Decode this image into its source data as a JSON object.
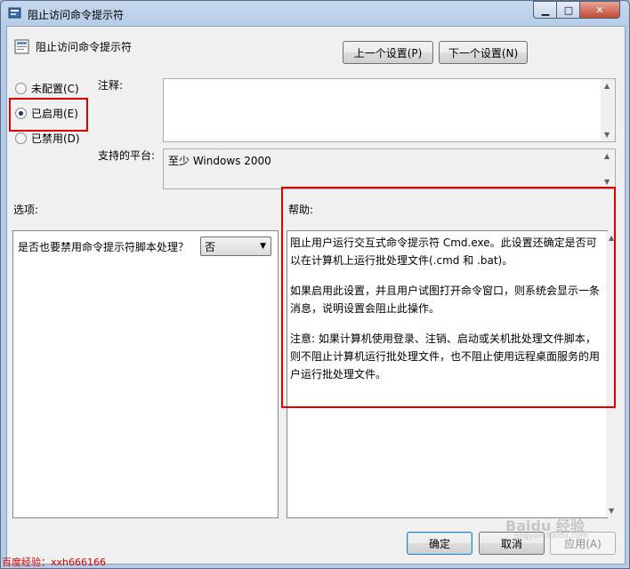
{
  "window": {
    "title": "阻止访问命令提示符"
  },
  "caption_buttons": {
    "minimize": "▁",
    "maximize": "□",
    "close": "✕"
  },
  "header": {
    "title": "阻止访问命令提示符"
  },
  "nav": {
    "prev_label": "上一个设置(P)",
    "next_label": "下一个设置(N)"
  },
  "state": {
    "options": [
      {
        "label": "未配置(C)",
        "checked": false
      },
      {
        "label": "已启用(E)",
        "checked": true
      },
      {
        "label": "已禁用(D)",
        "checked": false
      }
    ]
  },
  "comment": {
    "label": "注释:",
    "value": ""
  },
  "platform": {
    "label": "支持的平台:",
    "value": "至少 Windows 2000"
  },
  "options_section": {
    "label": "选项:",
    "question": "是否也要禁用命令提示符脚本处理？",
    "select_value": "否"
  },
  "help_section": {
    "label": "帮助:",
    "paragraphs": [
      "阻止用户运行交互式命令提示符 Cmd.exe。此设置还确定是否可以在计算机上运行批处理文件(.cmd 和 .bat)。",
      "如果启用此设置，并且用户试图打开命令窗口，则系统会显示一条消息，说明设置会阻止此操作。",
      "注意: 如果计算机使用登录、注销、启动或关机批处理文件脚本，则不阻止计算机运行批处理文件，也不阻止使用远程桌面服务的用户运行批处理文件。"
    ]
  },
  "footer": {
    "ok_label": "确定",
    "cancel_label": "取消",
    "apply_label": "应用(A)"
  },
  "watermark": {
    "left_text": "百度经验：xxh666166",
    "right_text": "Baidu 经验",
    "right_sub": "jingyan.baidu.com"
  },
  "colors": {
    "highlight": "#e00000",
    "title_bg": "#b5cbe6"
  }
}
